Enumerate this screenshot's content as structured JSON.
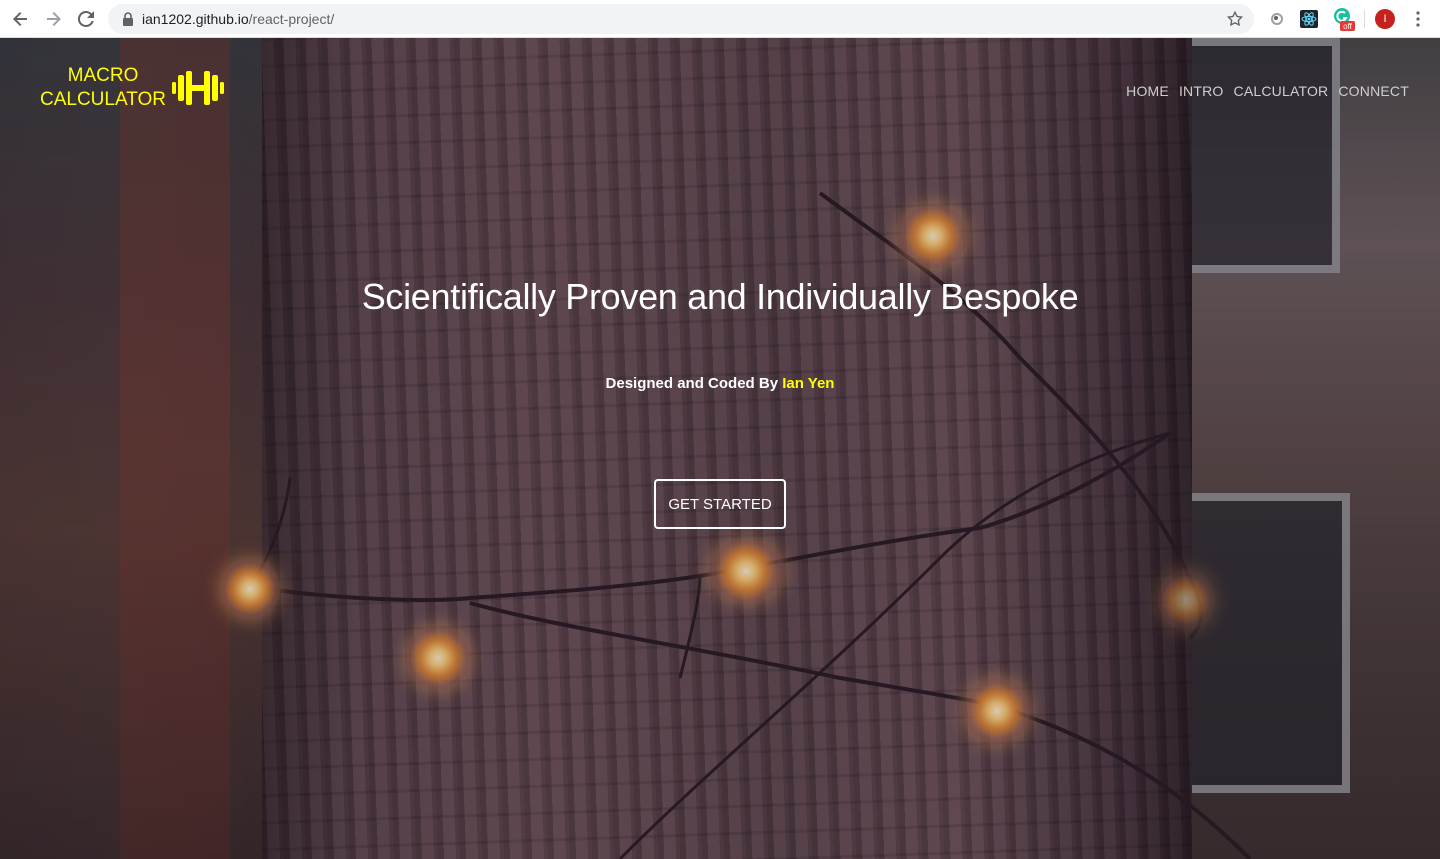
{
  "browser": {
    "url_host": "ian1202.github.io",
    "url_path": "/react-project/",
    "profile_initial": "I",
    "extension_badge": "off",
    "icons": [
      "back-arrow-icon",
      "forward-arrow-icon",
      "reload-icon",
      "lock-icon",
      "bookmark-star-icon",
      "extension-circle-icon",
      "react-devtools-icon",
      "grammarly-icon",
      "profile-avatar",
      "more-vert-icon"
    ]
  },
  "site": {
    "logo_line1": "MACRO",
    "logo_line2": "CALCULATOR",
    "logo_icon": "dumbbell-icon",
    "nav": [
      "HOME",
      "INTRO",
      "CALCULATOR",
      "CONNECT"
    ],
    "hero_title": "Scientifically Proven and Individually Bespoke",
    "credit_prefix": "Designed and Coded By",
    "credit_name": "Ian Yen",
    "cta_label": "GET STARTED"
  },
  "colors": {
    "accent": "#ffff00",
    "text": "#ffffff",
    "nav_text": "#cfcfcf",
    "profile_avatar": "#c5221f"
  }
}
